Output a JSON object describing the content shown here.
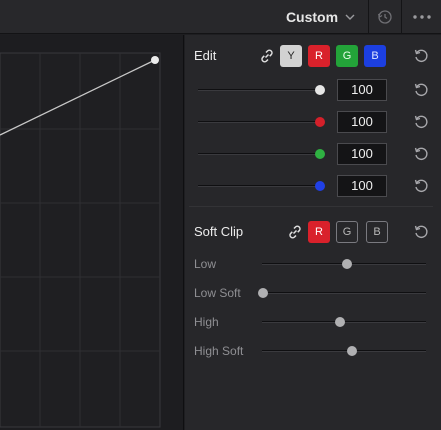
{
  "header": {
    "preset_label": "Custom"
  },
  "edit": {
    "title": "Edit",
    "channels": [
      "Y",
      "R",
      "G",
      "B"
    ],
    "values": {
      "y": "100",
      "r": "100",
      "g": "100",
      "b": "100"
    }
  },
  "soft_clip": {
    "title": "Soft Clip",
    "channels": [
      "R",
      "G",
      "B"
    ],
    "rows": [
      {
        "label": "Low",
        "level": 0.51
      },
      {
        "label": "Low Soft",
        "level": 0.0
      },
      {
        "label": "High",
        "level": 0.47
      },
      {
        "label": "High Soft",
        "level": 0.54
      }
    ]
  },
  "colors": {
    "red": "#d9212b",
    "green": "#23a339",
    "blue": "#1c3fe0",
    "y": "#d2d2d2"
  },
  "icons": {
    "preset_dropdown": "chevron-down-icon",
    "history": "history-reset-icon",
    "more": "more-options-icon",
    "link": "link-icon",
    "reset": "reset-icon"
  }
}
